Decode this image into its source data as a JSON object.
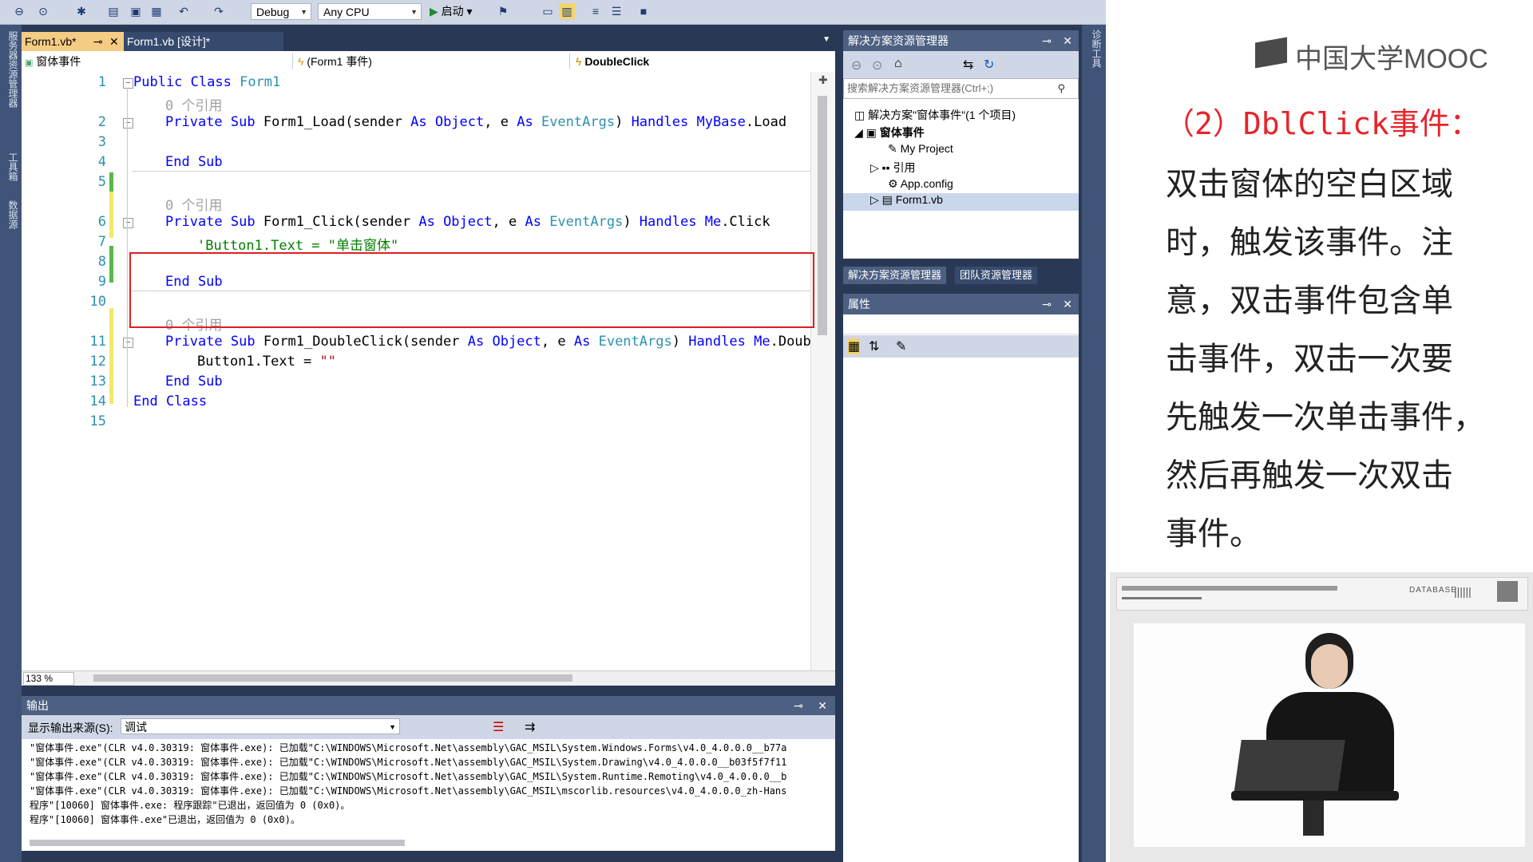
{
  "toolbar": {
    "config": "Debug",
    "platform": "Any CPU",
    "start_label": "启动"
  },
  "left_strip_labels": [
    "服务器资源管理器",
    "工具箱",
    "数据源"
  ],
  "doc_tabs": [
    {
      "label": "Form1.vb*",
      "active": true
    },
    {
      "label": "Form1.vb [设计]*",
      "active": false
    }
  ],
  "navbar": {
    "class_combo": "窗体事件",
    "object_combo": "(Form1 事件)",
    "event_combo": "DoubleClick"
  },
  "editor": {
    "line_numbers": [
      "1",
      "2",
      "3",
      "4",
      "5",
      "6",
      "7",
      "8",
      "9",
      "10",
      "11",
      "12",
      "13",
      "14",
      "15"
    ],
    "ref_zero": "0 个引用",
    "lines": {
      "l1_kw": "Public Class",
      "l1_ty": "Form1",
      "l2_kw1": "Private Sub",
      "l2_name": "Form1_Load(sender",
      "l2_as1": "As",
      "l2_obj": "Object",
      "l2_e": ", e",
      "l2_as2": "As",
      "l2_ev": "EventArgs",
      "l2_hand": "Handles",
      "l2_mb": "MyBase",
      "l2_load": ".Load",
      "l4": "End Sub",
      "l6_kw1": "Private Sub",
      "l6_name": "Form1_Click(sender",
      "l6_hand": "Handles",
      "l6_me": "Me",
      "l6_click": ".Click",
      "l7_comment": "'Button1.Text = \"单击窗体\"",
      "l9": "End Sub",
      "l11_kw1": "Private Sub",
      "l11_name": "Form1_DoubleClick(sender",
      "l11_hand": "Handles",
      "l11_me": "Me",
      "l11_tail": ".Doub",
      "l12": "Button1.Text = ",
      "l12_str": "\"\"",
      "l13": "End Sub",
      "l14": "End Class"
    }
  },
  "zoom": "133 %",
  "output": {
    "title": "输出",
    "source_label": "显示输出来源(S):",
    "source_value": "调试",
    "lines": [
      "\"窗体事件.exe\"(CLR v4.0.30319: 窗体事件.exe): 已加载\"C:\\WINDOWS\\Microsoft.Net\\assembly\\GAC_MSIL\\System.Windows.Forms\\v4.0_4.0.0.0__b77a",
      "\"窗体事件.exe\"(CLR v4.0.30319: 窗体事件.exe): 已加载\"C:\\WINDOWS\\Microsoft.Net\\assembly\\GAC_MSIL\\System.Drawing\\v4.0_4.0.0.0__b03f5f7f11",
      "\"窗体事件.exe\"(CLR v4.0.30319: 窗体事件.exe): 已加载\"C:\\WINDOWS\\Microsoft.Net\\assembly\\GAC_MSIL\\System.Runtime.Remoting\\v4.0_4.0.0.0__b",
      "\"窗体事件.exe\"(CLR v4.0.30319: 窗体事件.exe): 已加载\"C:\\WINDOWS\\Microsoft.Net\\assembly\\GAC_MSIL\\mscorlib.resources\\v4.0_4.0.0.0_zh-Hans",
      "程序\"[10060] 窗体事件.exe: 程序跟踪\"已退出，返回值为 0 (0x0)。",
      "程序\"[10060] 窗体事件.exe\"已退出，返回值为 0 (0x0)。"
    ]
  },
  "solution": {
    "title": "解决方案资源管理器",
    "search_placeholder": "搜索解决方案资源管理器(Ctrl+;)",
    "items": [
      "解决方案\"窗体事件\"(1 个项目)",
      "窗体事件",
      "My Project",
      "引用",
      "App.config",
      "Form1.vb"
    ],
    "tabs": [
      "解决方案资源管理器",
      "团队资源管理器"
    ]
  },
  "properties": {
    "title": "属性"
  },
  "right_strip_label": "诊断工具",
  "slide": {
    "logo_text": "中国大学MOOC",
    "title": "（2）DblClick事件：",
    "paragraph_lines": [
      "双击窗体的空白区域",
      "时，触发该事件。注",
      "意，双击事件包含单",
      "击事件，双击一次要",
      "先触发一次单击事件，",
      "然后再触发一次双击",
      "事件。"
    ],
    "video_banner": "DATABASE"
  },
  "colors": {
    "ide_frame": "#293955",
    "panel_header": "#4d6082",
    "keyword": "#0000ff",
    "type": "#2b91af",
    "highlight_box": "#e01e24",
    "slide_title": "#e5242c"
  }
}
